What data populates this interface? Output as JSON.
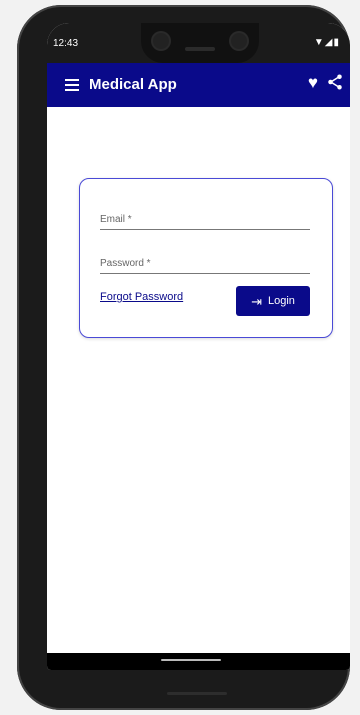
{
  "status_bar": {
    "time": "12:43",
    "indicators": "▼◢▮"
  },
  "app_bar": {
    "title": "Medical App",
    "menu_icon": "hamburger-menu-icon",
    "favorite_icon": "heart-icon",
    "share_icon": "share-icon"
  },
  "login_form": {
    "email_label": "Email *",
    "password_label": "Password *",
    "forgot_label": "Forgot Password",
    "login_label": "Login",
    "login_icon": "login-arrow-icon"
  },
  "colors": {
    "primary": "#0a0a8a",
    "card_border": "#4a4ad6"
  }
}
